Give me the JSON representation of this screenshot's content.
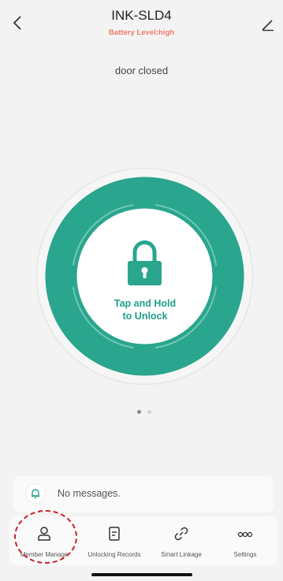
{
  "header": {
    "title": "INK-SLD4",
    "battery": "Battery Level:high",
    "back_icon": "chevron-left-icon",
    "edit_icon": "pencil-icon"
  },
  "status": {
    "door": "door closed"
  },
  "lock": {
    "icon": "padlock-icon",
    "label_line1": "Tap and Hold",
    "label_line2": "to Unlock",
    "accent_color": "#2aa58e"
  },
  "pager": {
    "pages": 2,
    "active": 1
  },
  "messages": {
    "icon": "bell-icon",
    "text": "No messages."
  },
  "tabs": [
    {
      "label": "Member Manage",
      "icon": "person-icon"
    },
    {
      "label": "Unlocking Records",
      "icon": "document-icon"
    },
    {
      "label": "Smart Linkage",
      "icon": "link-icon"
    },
    {
      "label": "Settings",
      "icon": "more-dots-icon"
    }
  ],
  "highlight_color": "#cc1f2a"
}
